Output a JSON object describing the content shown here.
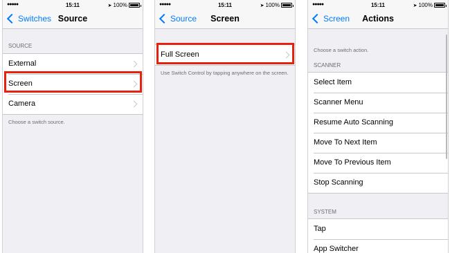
{
  "status": {
    "signal": "●●●●●",
    "time": "15:11",
    "battery": "100%"
  },
  "panel1": {
    "back": "Switches",
    "title": "Source",
    "section": "SOURCE",
    "items": [
      {
        "label": "External"
      },
      {
        "label": "Screen"
      },
      {
        "label": "Camera"
      }
    ],
    "footer": "Choose a switch source."
  },
  "panel2": {
    "back": "Source",
    "title": "Screen",
    "items": [
      {
        "label": "Full Screen"
      }
    ],
    "footer": "Use Switch Control by tapping anywhere on the screen."
  },
  "panel3": {
    "back": "Screen",
    "title": "Actions",
    "note": "Choose a switch action.",
    "scanner_header": "SCANNER",
    "scanner_items": [
      {
        "label": "Select Item"
      },
      {
        "label": "Scanner Menu"
      },
      {
        "label": "Resume Auto Scanning"
      },
      {
        "label": "Move To Next Item"
      },
      {
        "label": "Move To Previous Item"
      },
      {
        "label": "Stop Scanning"
      }
    ],
    "system_header": "SYSTEM",
    "system_items": [
      {
        "label": "Tap"
      },
      {
        "label": "App Switcher"
      }
    ]
  },
  "colors": {
    "accent": "#007aff",
    "highlight": "#e8210f",
    "background": "#efeff4"
  }
}
